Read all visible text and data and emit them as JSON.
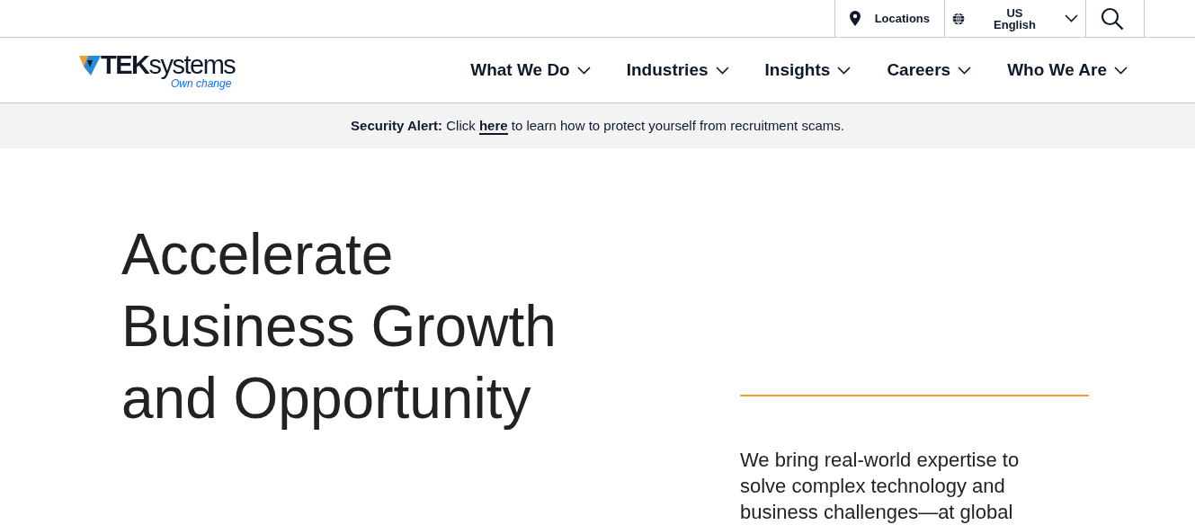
{
  "utility_bar": {
    "locations": "Locations",
    "region": "US",
    "language": "English"
  },
  "logo": {
    "wordmark": "**TEK**systems",
    "tagline": "Own change"
  },
  "nav": [
    {
      "label": "What We Do"
    },
    {
      "label": "Industries"
    },
    {
      "label": "Insights"
    },
    {
      "label": "Careers"
    },
    {
      "label": "Who We Are"
    }
  ],
  "alert": {
    "label": "Security Alert:",
    "before": "Click",
    "link": "here",
    "after": "to learn how to protect yourself from recruitment scams."
  },
  "hero": {
    "heading_lines": [
      "Accelerate",
      "Business Growth",
      "and Opportunity"
    ],
    "description": "We bring real-world expertise to solve complex technology and business challenges—at global"
  }
}
